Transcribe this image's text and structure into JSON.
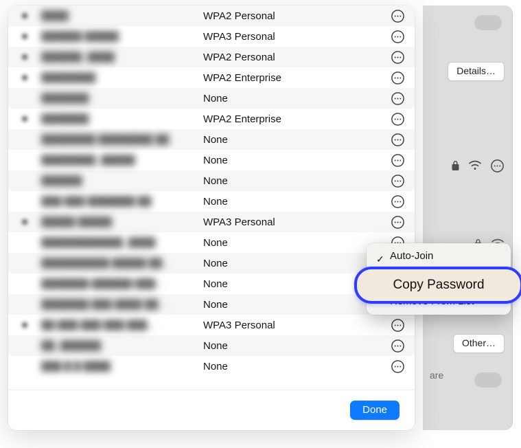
{
  "back": {
    "details_label": "Details…",
    "other_label": "Other…",
    "partial_label": "are"
  },
  "rows": [
    {
      "bullet": true,
      "name": "████",
      "security": "WPA2 Personal",
      "has_more": true,
      "shade": "a"
    },
    {
      "bullet": true,
      "name": "██████ █████",
      "security": "WPA3 Personal",
      "has_more": true,
      "shade": "b"
    },
    {
      "bullet": true,
      "name": "██████_████",
      "security": "WPA2 Personal",
      "has_more": true,
      "shade": "a"
    },
    {
      "bullet": true,
      "name": "████████",
      "security": "WPA2 Enterprise",
      "has_more": true,
      "shade": "b"
    },
    {
      "bullet": false,
      "name": "███████",
      "security": "None",
      "has_more": true,
      "shade": "a"
    },
    {
      "bullet": true,
      "name": "███████",
      "security": "WPA2 Enterprise",
      "has_more": true,
      "shade": "b"
    },
    {
      "bullet": false,
      "name": "████████ ████████ ██",
      "security": "None",
      "has_more": true,
      "shade": "a"
    },
    {
      "bullet": false,
      "name": "████████_█████",
      "security": "None",
      "has_more": true,
      "shade": "b"
    },
    {
      "bullet": false,
      "name": "██████",
      "security": "None",
      "has_more": true,
      "shade": "a"
    },
    {
      "bullet": false,
      "name": "███ ███ ███████ ██",
      "security": "None",
      "has_more": true,
      "shade": "b"
    },
    {
      "bullet": true,
      "name": "█████ █████",
      "security": "WPA3 Personal",
      "has_more": true,
      "shade": "a"
    },
    {
      "bullet": false,
      "name": "████████████_████",
      "security": "None",
      "has_more": true,
      "shade": "b"
    },
    {
      "bullet": false,
      "name": "██████████ █████ ██…",
      "security": "None",
      "has_more": true,
      "shade": "a"
    },
    {
      "bullet": false,
      "name": "███████ ██████ ███…",
      "security": "None",
      "has_more": true,
      "shade": "b"
    },
    {
      "bullet": false,
      "name": "███████ ███ ████ ██…",
      "security": "None",
      "has_more": true,
      "shade": "a"
    },
    {
      "bullet": true,
      "name": "██ ███ ███ ███ ███…",
      "security": "WPA3 Personal",
      "has_more": true,
      "shade": "b"
    },
    {
      "bullet": false,
      "name": "██_██████",
      "security": "None",
      "has_more": true,
      "shade": "a"
    },
    {
      "bullet": false,
      "name": "███ █ █ ████",
      "security": "None",
      "has_more": true,
      "shade": "b"
    }
  ],
  "done_label": "Done",
  "menu": {
    "auto_join": "Auto-Join",
    "copy_password": "Copy Password",
    "remove": "Remove From List"
  }
}
